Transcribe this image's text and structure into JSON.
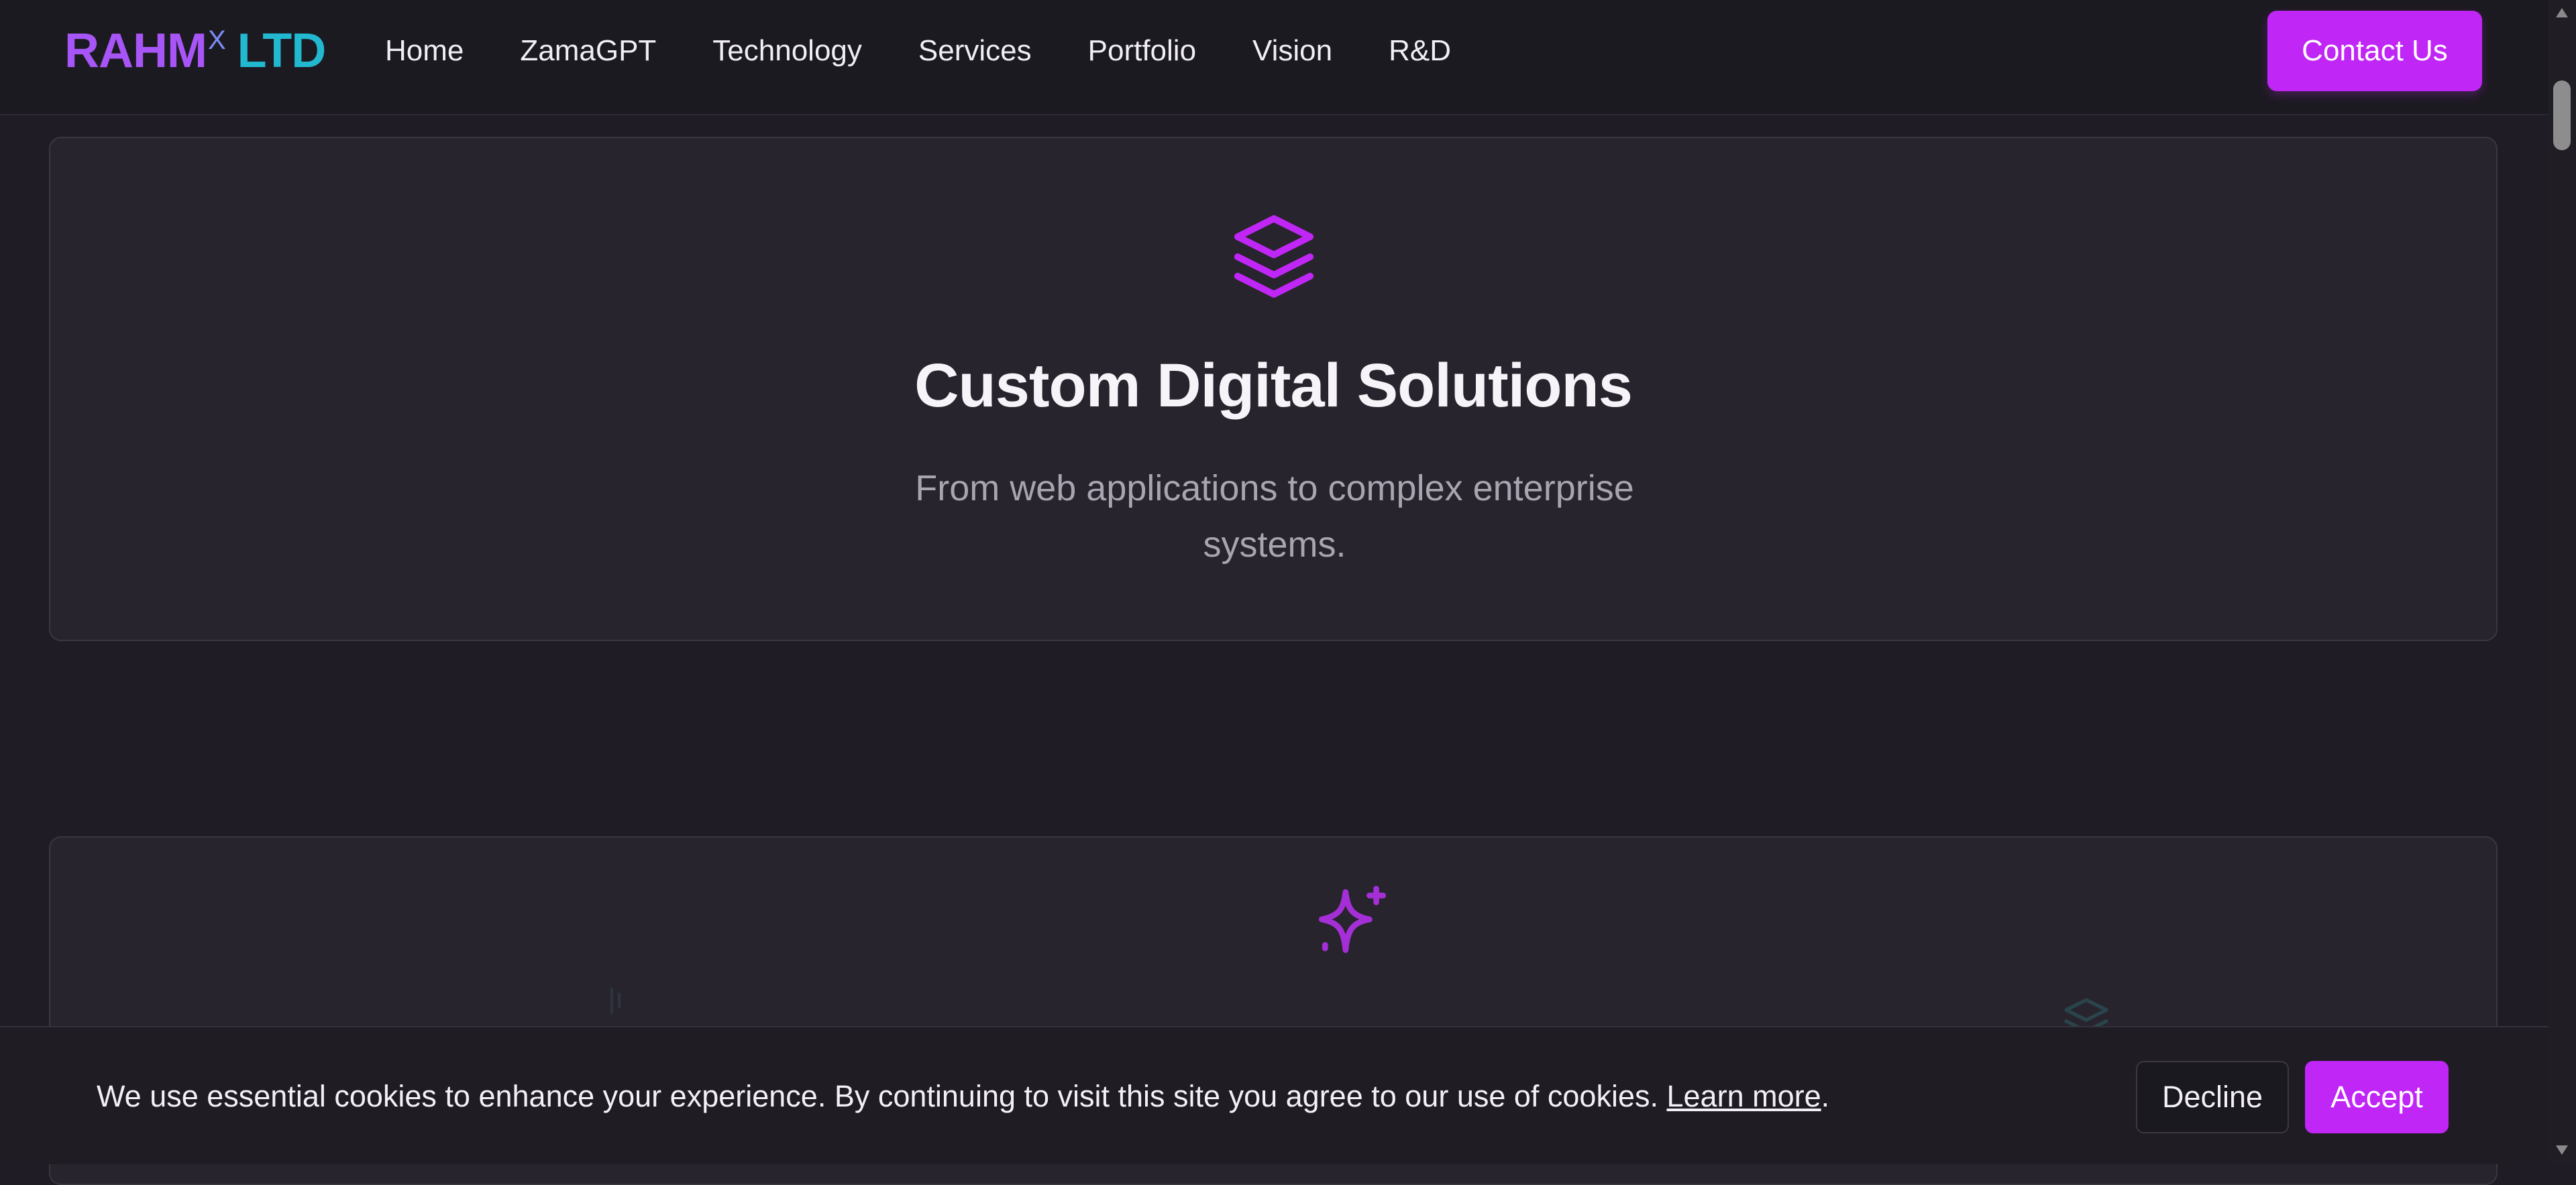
{
  "header": {
    "logo": {
      "part1": "RAHM",
      "superscript": "X",
      "part2": "LTD"
    },
    "nav": [
      {
        "label": "Home"
      },
      {
        "label": "ZamaGPT"
      },
      {
        "label": "Technology"
      },
      {
        "label": "Services"
      },
      {
        "label": "Portfolio"
      },
      {
        "label": "Vision"
      },
      {
        "label": "R&D"
      }
    ],
    "contact_label": "Contact Us"
  },
  "cards": [
    {
      "icon": "layers-icon",
      "title": "Custom Digital Solutions",
      "description": "From web applications to complex enterprise systems."
    },
    {
      "icon": "sparkles-icon"
    }
  ],
  "cookie": {
    "message": "We use essential cookies to enhance your experience. By continuing to visit this site you agree to our use of cookies.",
    "link_label": "Learn more",
    "trailing": ".",
    "decline_label": "Decline",
    "accept_label": "Accept"
  },
  "colors": {
    "accent": "#c026f5",
    "logo_purple": "#a855f7",
    "logo_cyan": "#22b8cf",
    "background": "#1f1c25",
    "card": "#27242d"
  }
}
